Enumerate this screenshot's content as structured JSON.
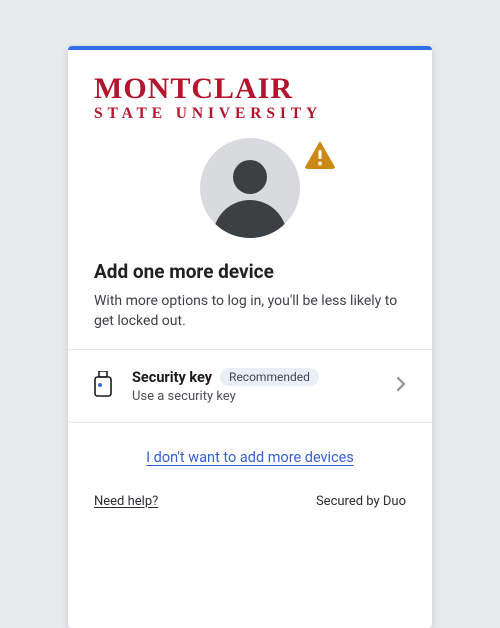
{
  "brand": {
    "line1": "MONTCLAIR",
    "line2": "STATE UNIVERSITY"
  },
  "heading": "Add one more device",
  "subtext": "With more options to log in, you'll be less likely to get locked out.",
  "option": {
    "title": "Security key",
    "badge": "Recommended",
    "subtitle": "Use a security key"
  },
  "skip_label": "I don't want to add more devices",
  "footer": {
    "help": "Need help?",
    "secured": "Secured by Duo"
  },
  "colors": {
    "accent": "#2f6fe8",
    "brand": "#b4152e",
    "warn": "#cc8a14"
  }
}
